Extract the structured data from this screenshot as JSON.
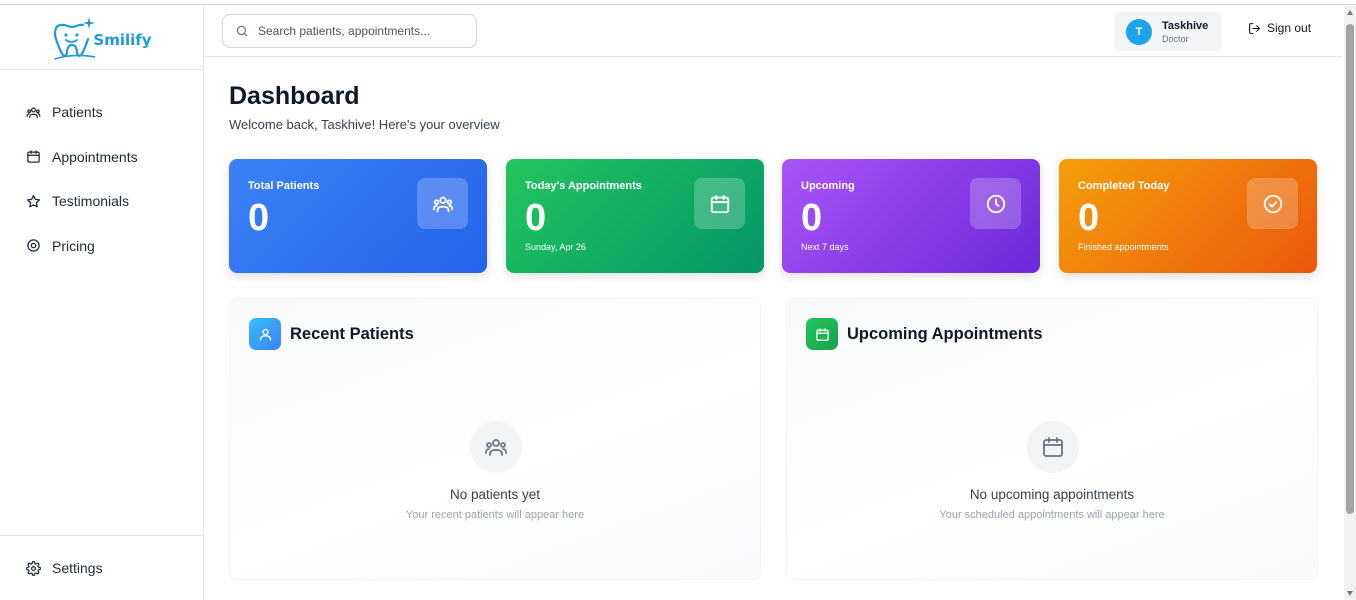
{
  "app": {
    "logo_text": "Smilify"
  },
  "sidebar": {
    "items": [
      {
        "label": "Patients",
        "icon": "users-icon"
      },
      {
        "label": "Appointments",
        "icon": "calendar-icon"
      },
      {
        "label": "Testimonials",
        "icon": "star-icon"
      },
      {
        "label": "Pricing",
        "icon": "target-icon"
      }
    ],
    "settings_label": "Settings"
  },
  "header": {
    "search_placeholder": "Search patients, appointments...",
    "user": {
      "initial": "T",
      "name": "Taskhive",
      "role": "Doctor"
    },
    "signout_label": "Sign out"
  },
  "main": {
    "title": "Dashboard",
    "subtitle": "Welcome back, Taskhive! Here's your overview",
    "stats": [
      {
        "label": "Total Patients",
        "value": "0",
        "sub": "",
        "color": "#3b82f6",
        "icon": "users-icon"
      },
      {
        "label": "Today's Appointments",
        "value": "0",
        "sub": "Sunday, Apr 26",
        "color": "#22c55e",
        "icon": "calendar-icon"
      },
      {
        "label": "Upcoming",
        "value": "0",
        "sub": "Next 7 days",
        "color": "#8b5cf6",
        "icon": "clock-icon"
      },
      {
        "label": "Completed Today",
        "value": "0",
        "sub": "Finished appointments",
        "color": "#f97316",
        "icon": "check-circle-icon"
      }
    ],
    "panels": [
      {
        "title": "Recent Patients",
        "empty_title": "No patients yet",
        "empty_sub": "Your recent patients will appear here",
        "icon": "user-icon"
      },
      {
        "title": "Upcoming Appointments",
        "empty_title": "No upcoming appointments",
        "empty_sub": "Your scheduled appointments will appear here",
        "icon": "calendar-icon"
      }
    ]
  }
}
